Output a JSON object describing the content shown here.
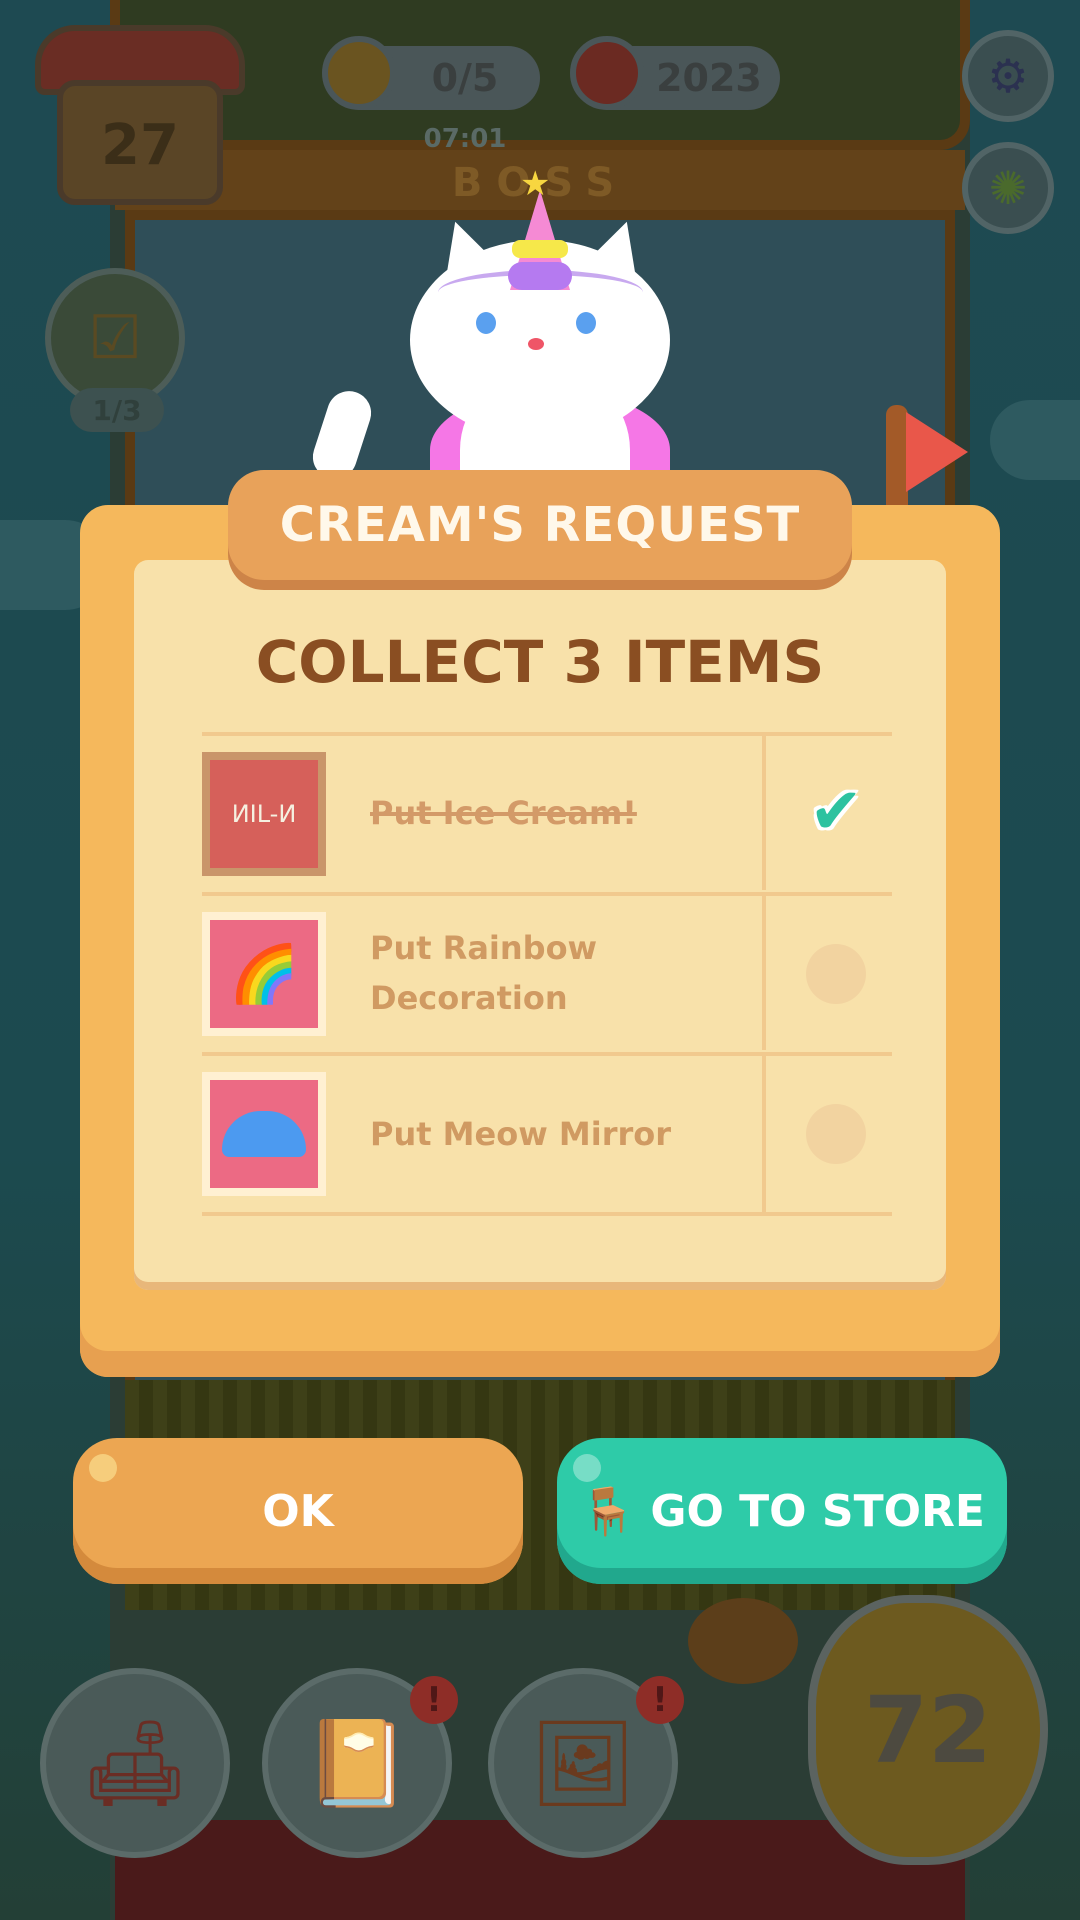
{
  "hud": {
    "house_level": "27",
    "pencil_progress": "0/5",
    "timer": "07:01",
    "cans": "2023",
    "boss_label": "BOSS",
    "quest_progress": "1/3",
    "play_count": "72"
  },
  "popup": {
    "title": "CREAM'S REQUEST",
    "subtitle": "COLLECT 3 ITEMS",
    "tasks": [
      {
        "label": "Put Ice Cream!",
        "completed": true,
        "icon": "ice-cream-poster-icon",
        "thumb_text": "ИІL-И"
      },
      {
        "label": "Put Rainbow Decoration",
        "completed": false,
        "icon": "rainbow-icon"
      },
      {
        "label": "Put Meow Mirror",
        "completed": false,
        "icon": "cat-mirror-icon"
      }
    ]
  },
  "buttons": {
    "ok": "OK",
    "store": "GO TO STORE"
  },
  "colors": {
    "accent_orange": "#eca652",
    "accent_teal": "#2ecba8",
    "title_brown": "#8a4e22"
  },
  "nav": {
    "badges": [
      "!",
      "!"
    ]
  }
}
